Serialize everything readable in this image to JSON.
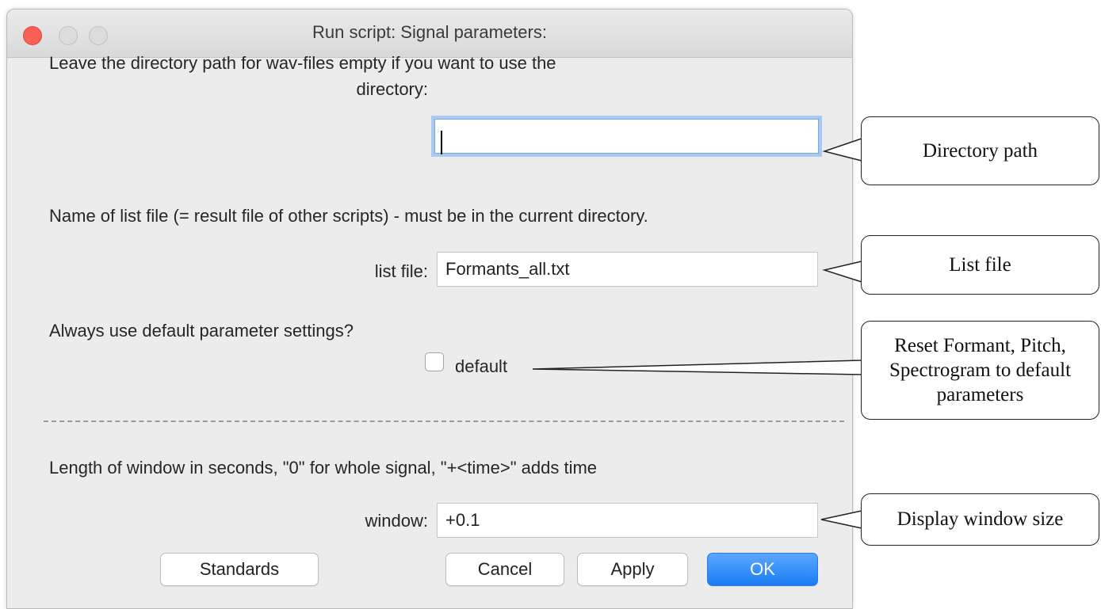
{
  "window": {
    "title": "Run script: Signal parameters:"
  },
  "sections": {
    "directory_hint": "Leave the directory path for wav-files empty if you want to use the",
    "directory_label": "directory:",
    "directory_value": "",
    "list_hint": "Name of list file (= result file of other scripts) - must be in the current directory.",
    "list_label": "list file:",
    "list_value": "Formants_all.txt",
    "default_hint": "Always use default parameter settings?",
    "default_label": "default",
    "default_checked": false,
    "window_hint": "Length of window in seconds, \"0\" for whole signal, \"+<time>\" adds time",
    "window_label": "window:",
    "window_value": "+0.1"
  },
  "buttons": {
    "standards": "Standards",
    "cancel": "Cancel",
    "apply": "Apply",
    "ok": "OK"
  },
  "callouts": {
    "directory": "Directory path",
    "list": "List file",
    "default_line1": "Reset Formant, Pitch,",
    "default_line2": "Spectrogram to default",
    "default_line3": "parameters",
    "window": "Display window size"
  },
  "colors": {
    "close_button": "#fc5f57",
    "focus_ring": "#a9c8f2",
    "primary_button": "#1a7cf4",
    "window_bg": "#ececec"
  }
}
